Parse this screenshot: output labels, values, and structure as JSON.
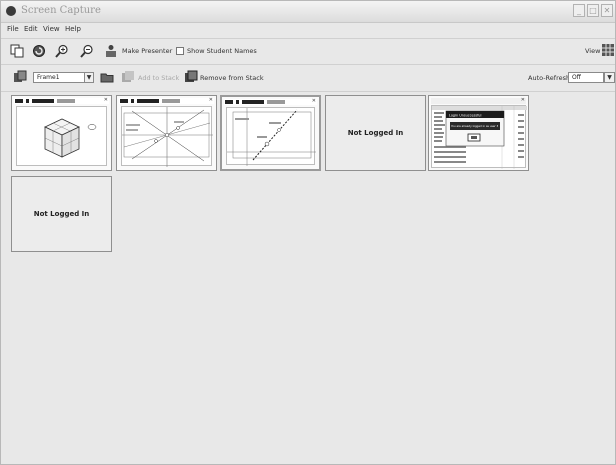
{
  "window": {
    "title": "Screen Capture"
  },
  "menu": [
    "File",
    "Edit",
    "View",
    "Help"
  ],
  "toolbar": {
    "make_presenter": "Make Presenter",
    "show_student_names": "Show Student Names",
    "view": "View"
  },
  "toolbar2": {
    "frame_value": "Frame1",
    "add_to_stack": "Add to Stack",
    "remove_from_stack": "Remove from Stack",
    "auto_refresh_label": "Auto-Refresh:",
    "auto_refresh_value": "Off"
  },
  "thumbnails": {
    "not_logged_in": "Not Logged In",
    "dialog_title": "Login Unsuccessful",
    "dialog_message": "You are already logged in as user 3"
  },
  "colors": {
    "window_bg": "#e8e8e8",
    "thumb_border": "#8f8f8f"
  }
}
